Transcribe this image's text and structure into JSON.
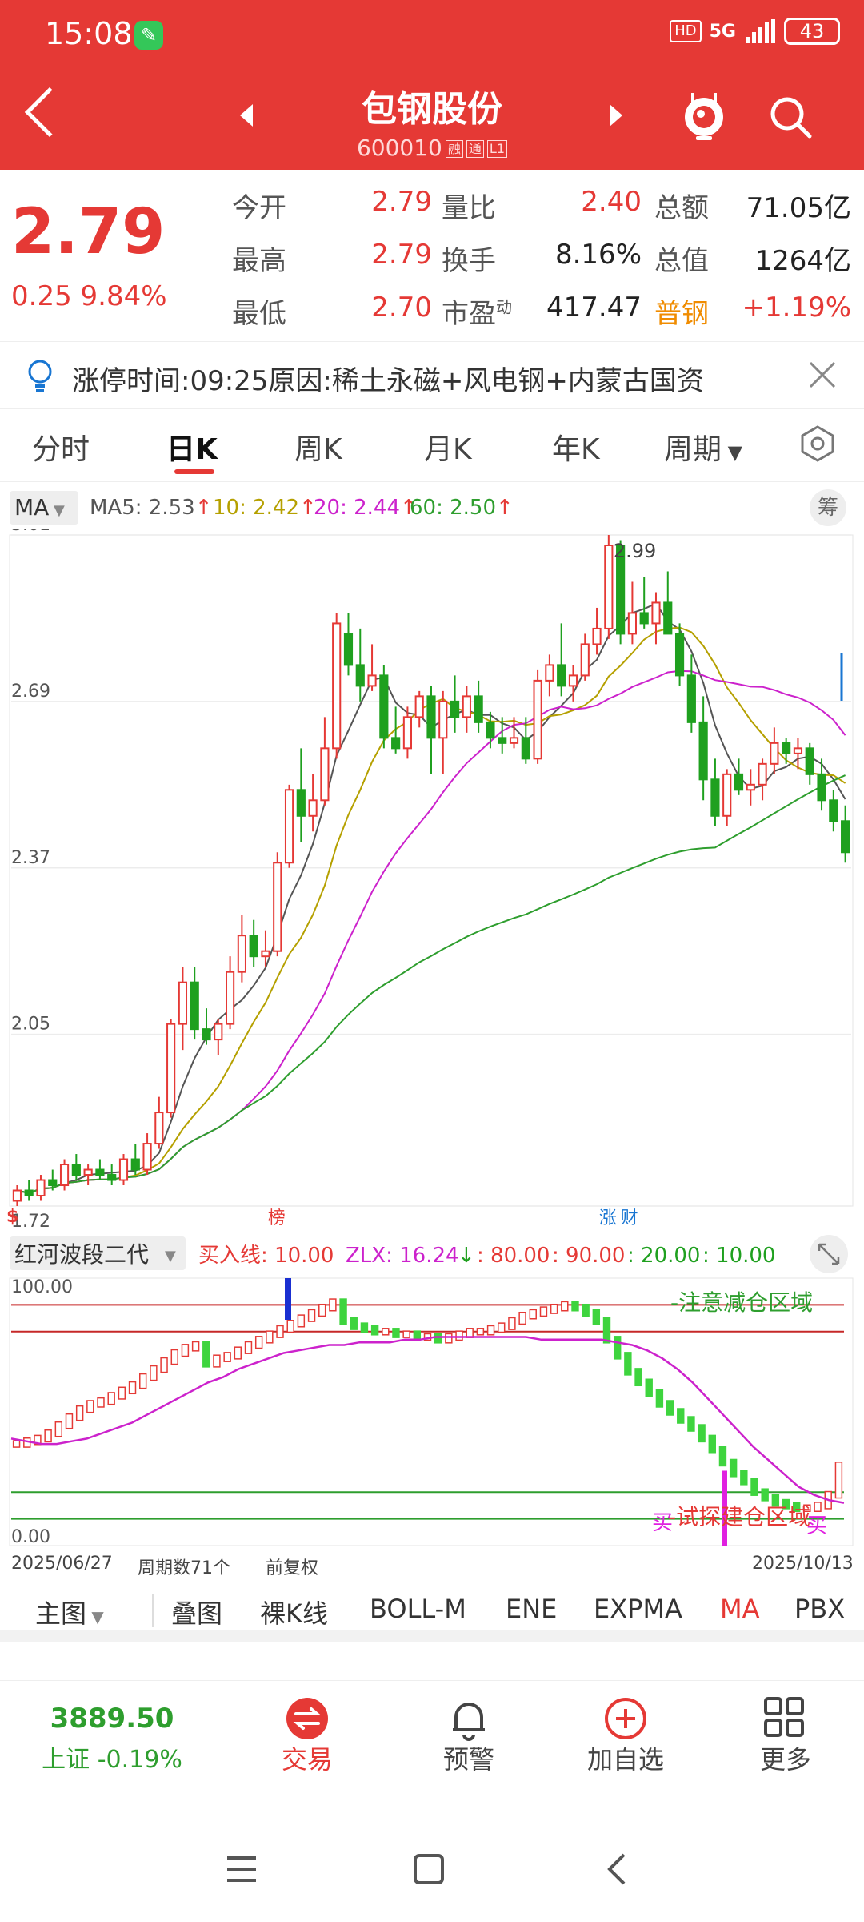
{
  "status_bar": {
    "time": "15:08",
    "network": "5G",
    "hd": "HD",
    "battery": "43"
  },
  "header": {
    "title": "包钢股份",
    "code": "600010",
    "tag1": "融",
    "tag2": "通",
    "tag3": "L1"
  },
  "quote": {
    "price": "2.79",
    "change": "0.25 9.84%",
    "rows": [
      {
        "l1": "今开",
        "v1": "2.79",
        "l2": "量比",
        "v2": "2.40",
        "l3": "总额",
        "v3": "71.05亿"
      },
      {
        "l1": "最高",
        "v1": "2.79",
        "l2": "换手",
        "v2": "8.16%",
        "l3": "总值",
        "v3": "1264亿"
      },
      {
        "l1": "最低",
        "v1": "2.70",
        "l2": "市盈",
        "l2_sup": "动",
        "v2": "417.47",
        "l3": "普钢",
        "v3": "+1.19%"
      }
    ]
  },
  "notice": {
    "text": "涨停时间:09:25原因:稀土永磁+风电钢+内蒙古国资"
  },
  "tabs": [
    "分时",
    "日K",
    "周K",
    "月K",
    "年K",
    "周期"
  ],
  "ma_legend": {
    "selector": "MA",
    "ma5": "MA5: 2.53",
    "ma10": "10: 2.42",
    "ma20": "20: 2.44",
    "ma60": "60: 2.50",
    "chip": "筹"
  },
  "chart_data": [
    {
      "type": "candlestick",
      "title": "",
      "y_ticks": [
        "3.01",
        "2.69",
        "2.37",
        "2.05",
        "1.72"
      ],
      "ylim": [
        1.72,
        3.01
      ],
      "max_label": "2.99",
      "markers": [
        "榜",
        "涨",
        "财"
      ],
      "ohlc": [
        [
          1.73,
          1.76,
          1.72,
          1.75
        ],
        [
          1.75,
          1.77,
          1.73,
          1.74
        ],
        [
          1.74,
          1.78,
          1.73,
          1.77
        ],
        [
          1.77,
          1.79,
          1.75,
          1.76
        ],
        [
          1.76,
          1.81,
          1.75,
          1.8
        ],
        [
          1.8,
          1.82,
          1.77,
          1.78
        ],
        [
          1.78,
          1.8,
          1.76,
          1.79
        ],
        [
          1.79,
          1.81,
          1.77,
          1.78
        ],
        [
          1.78,
          1.8,
          1.76,
          1.77
        ],
        [
          1.77,
          1.82,
          1.76,
          1.81
        ],
        [
          1.81,
          1.84,
          1.78,
          1.79
        ],
        [
          1.79,
          1.86,
          1.78,
          1.84
        ],
        [
          1.84,
          1.93,
          1.83,
          1.9
        ],
        [
          1.9,
          2.08,
          1.89,
          2.07
        ],
        [
          2.07,
          2.18,
          2.02,
          2.15
        ],
        [
          2.15,
          2.18,
          2.04,
          2.06
        ],
        [
          2.06,
          2.1,
          2.03,
          2.04
        ],
        [
          2.04,
          2.08,
          2.01,
          2.07
        ],
        [
          2.07,
          2.2,
          2.06,
          2.17
        ],
        [
          2.17,
          2.28,
          2.15,
          2.24
        ],
        [
          2.24,
          2.27,
          2.18,
          2.2
        ],
        [
          2.2,
          2.25,
          2.18,
          2.21
        ],
        [
          2.21,
          2.4,
          2.2,
          2.38
        ],
        [
          2.38,
          2.53,
          2.37,
          2.52
        ],
        [
          2.52,
          2.6,
          2.42,
          2.47
        ],
        [
          2.47,
          2.55,
          2.44,
          2.5
        ],
        [
          2.5,
          2.66,
          2.49,
          2.6
        ],
        [
          2.6,
          2.86,
          2.58,
          2.84
        ],
        [
          2.82,
          2.86,
          2.74,
          2.76
        ],
        [
          2.76,
          2.83,
          2.69,
          2.72
        ],
        [
          2.72,
          2.8,
          2.71,
          2.74
        ],
        [
          2.74,
          2.76,
          2.6,
          2.62
        ],
        [
          2.62,
          2.68,
          2.59,
          2.6
        ],
        [
          2.6,
          2.68,
          2.58,
          2.66
        ],
        [
          2.66,
          2.71,
          2.64,
          2.7
        ],
        [
          2.7,
          2.72,
          2.55,
          2.62
        ],
        [
          2.62,
          2.71,
          2.55,
          2.69
        ],
        [
          2.69,
          2.74,
          2.63,
          2.66
        ],
        [
          2.66,
          2.72,
          2.63,
          2.7
        ],
        [
          2.7,
          2.73,
          2.63,
          2.65
        ],
        [
          2.65,
          2.67,
          2.6,
          2.62
        ],
        [
          2.62,
          2.66,
          2.59,
          2.61
        ],
        [
          2.61,
          2.66,
          2.6,
          2.62
        ],
        [
          2.62,
          2.66,
          2.57,
          2.58
        ],
        [
          2.58,
          2.75,
          2.57,
          2.73
        ],
        [
          2.73,
          2.78,
          2.7,
          2.76
        ],
        [
          2.76,
          2.84,
          2.7,
          2.72
        ],
        [
          2.72,
          2.76,
          2.69,
          2.74
        ],
        [
          2.74,
          2.82,
          2.73,
          2.8
        ],
        [
          2.8,
          2.87,
          2.78,
          2.83
        ],
        [
          2.83,
          3.01,
          2.81,
          2.99
        ],
        [
          2.99,
          3.0,
          2.8,
          2.82
        ],
        [
          2.82,
          2.92,
          2.8,
          2.86
        ],
        [
          2.86,
          2.93,
          2.83,
          2.84
        ],
        [
          2.84,
          2.9,
          2.8,
          2.88
        ],
        [
          2.88,
          2.94,
          2.85,
          2.82
        ],
        [
          2.82,
          2.84,
          2.72,
          2.74
        ],
        [
          2.74,
          2.78,
          2.63,
          2.65
        ],
        [
          2.65,
          2.7,
          2.5,
          2.54
        ],
        [
          2.54,
          2.58,
          2.45,
          2.47
        ],
        [
          2.47,
          2.56,
          2.45,
          2.55
        ],
        [
          2.55,
          2.58,
          2.51,
          2.52
        ],
        [
          2.52,
          2.56,
          2.49,
          2.53
        ],
        [
          2.53,
          2.58,
          2.5,
          2.57
        ],
        [
          2.57,
          2.64,
          2.55,
          2.61
        ],
        [
          2.61,
          2.62,
          2.57,
          2.59
        ],
        [
          2.59,
          2.62,
          2.56,
          2.6
        ],
        [
          2.6,
          2.61,
          2.53,
          2.55
        ],
        [
          2.55,
          2.58,
          2.48,
          2.5
        ],
        [
          2.5,
          2.52,
          2.44,
          2.46
        ],
        [
          2.46,
          2.49,
          2.38,
          2.4
        ]
      ]
    },
    {
      "type": "oscillator",
      "title": "红河波段二代",
      "legend": {
        "buy": "买入线: 10.00",
        "zlx": "ZLX: 16.24",
        "l1": ": 80.00",
        "l2": ": 90.00",
        "l3": ": 20.00",
        "l4": ": 10.00"
      },
      "y_ticks": [
        "100.00",
        "0.00"
      ],
      "ylim": [
        0,
        100
      ],
      "levels": [
        90,
        80,
        20,
        10
      ],
      "zone_top": "-注意减仓区域",
      "zone_bottom": "-试探建仓区域",
      "buy_marks": [
        "买",
        "买"
      ],
      "values": [
        38,
        39,
        40,
        42,
        45,
        48,
        51,
        53,
        54,
        56,
        58,
        60,
        63,
        66,
        69,
        72,
        74,
        75,
        68,
        70,
        71,
        73,
        75,
        77,
        79,
        81,
        83,
        85,
        87,
        89,
        91,
        84,
        82,
        81,
        80,
        80,
        79,
        79,
        78,
        78,
        77,
        78,
        79,
        80,
        80,
        81,
        82,
        84,
        86,
        87,
        88,
        89,
        90,
        89,
        87,
        84,
        77,
        71,
        65,
        61,
        57,
        53,
        50,
        47,
        44,
        40,
        36,
        31,
        27,
        24,
        20,
        18,
        16,
        15,
        14,
        14,
        15,
        19,
        30
      ],
      "zlx": [
        40,
        39,
        38,
        38,
        39,
        40,
        42,
        44,
        46,
        49,
        52,
        55,
        58,
        61,
        63,
        66,
        68,
        70,
        72,
        73,
        74,
        75,
        75,
        76,
        76,
        76,
        77,
        77,
        78,
        78,
        78,
        78,
        78,
        78,
        78,
        77,
        77,
        77,
        77,
        77,
        76,
        75,
        73,
        70,
        66,
        61,
        55,
        49,
        43,
        37,
        32,
        27,
        22,
        19,
        17,
        16
      ]
    }
  ],
  "date_row": {
    "start": "2025/06/27",
    "period": "周期数71个",
    "adj": "前复权",
    "end": "2025/10/13"
  },
  "toolbar": [
    "主图",
    "叠图",
    "裸K线",
    "BOLL-M",
    "ENE",
    "EXPMA",
    "MA",
    "PBX"
  ],
  "nav": {
    "index_value": "3889.50",
    "index_label": "上证 -0.19%",
    "items": [
      "交易",
      "预警",
      "加自选",
      "更多"
    ]
  }
}
